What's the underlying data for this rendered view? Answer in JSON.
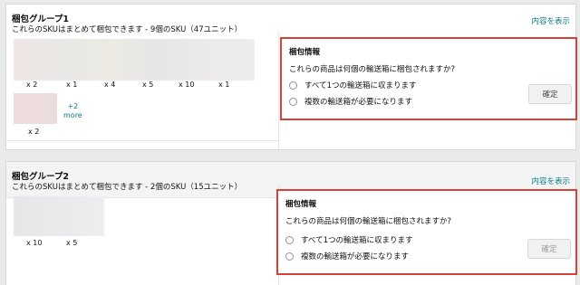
{
  "groups": [
    {
      "title": "梱包グループ1",
      "subtitle": "これらのSKUはまとめて梱包できます - 9個のSKU（47ユニット）",
      "show_link": "内容を表示",
      "quantities": [
        "x 2",
        "x 1",
        "x 4",
        "x 5",
        "x 10",
        "x 1"
      ],
      "extra_quantity": "x 2",
      "more_count": "+2",
      "more_label": "more",
      "info": {
        "title": "梱包情報",
        "question": "これらの商品は何個の輸送箱に梱包されますか?",
        "option_single": "すべて1つの輸送箱に収まります",
        "option_multiple": "複数の輸送箱が必要になります",
        "confirm": "確定"
      }
    },
    {
      "title": "梱包グループ2",
      "subtitle": "これらのSKUはまとめて梱包できます - 2個のSKU（15ユニット）",
      "show_link": "内容を表示",
      "quantities": [
        "x 10",
        "x 5"
      ],
      "info": {
        "title": "梱包情報",
        "question": "これらの商品は何個の輸送箱に梱包されますか?",
        "option_single": "すべて1つの輸送箱に収まります",
        "option_multiple": "複数の輸送箱が必要になります",
        "confirm": "確定"
      }
    }
  ],
  "colors": {
    "highlight_border": "#d9403a",
    "link": "#0a7b83",
    "background": "#e9eaea"
  }
}
